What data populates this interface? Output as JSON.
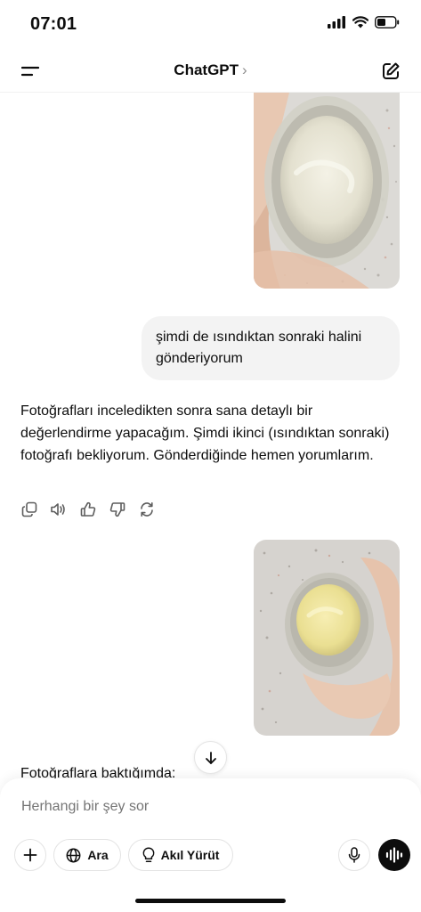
{
  "status_bar": {
    "time": "07:01"
  },
  "header": {
    "title": "ChatGPT",
    "chevron": "›"
  },
  "messages": {
    "user_text": "şimdi de ısındıktan sonraki halini gönderiyorum",
    "assistant_text": "Fotoğrafları inceledikten sonra sana detaylı bir değerlendirme yapacağım. Şimdi ikinci (ısındıktan sonraki) fotoğrafı bekliyorum. Gönderdiğinde hemen yorumlarım.",
    "assistant_text_2": "Fotoğraflara baktığımda:"
  },
  "composer": {
    "placeholder": "Herhangi bir şey sor",
    "search_label": "Ara",
    "reason_label": "Akıl Yürüt"
  },
  "icons": [
    "menu-icon",
    "new-chat-icon",
    "copy-icon",
    "speaker-icon",
    "thumbs-up-icon",
    "thumbs-down-icon",
    "regenerate-icon",
    "arrow-down-icon",
    "plus-icon",
    "globe-icon",
    "lightbulb-icon",
    "mic-icon",
    "voice-wave-icon",
    "signal-icon",
    "wifi-icon",
    "battery-icon"
  ],
  "colors": {
    "text": "#0d0d0d",
    "bubble": "#f3f3f3",
    "placeholder": "#8e8e8e",
    "voice_button": "#0d0d0d"
  }
}
